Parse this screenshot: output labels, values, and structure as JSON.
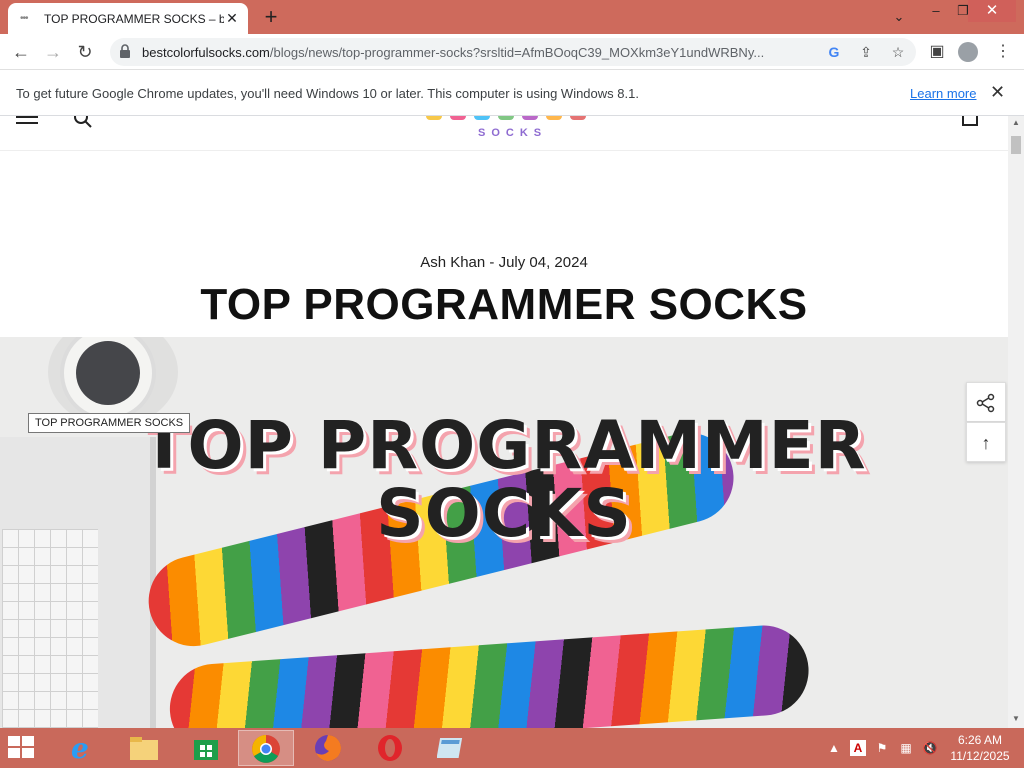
{
  "browser": {
    "tab_title": "TOP PROGRAMMER SOCKS – be",
    "new_tab_symbol": "+",
    "url_host": "bestcolorfulsocks.com",
    "url_rest": "/blogs/news/top-programmer-socks?srsltid=AfmBOoqC39_MOXkm3eY1undWRBNy...",
    "infobar_text": "To get future Google Chrome updates, you'll need Windows 10 or later. This computer is using Windows 8.1.",
    "infobar_link": "Learn more"
  },
  "site": {
    "logo_sub": "SOCKS",
    "logo_colors": [
      "#f7c84a",
      "#f06292",
      "#4fc3f7",
      "#81c784",
      "#ba68c8",
      "#ffb74d",
      "#e57373"
    ]
  },
  "article": {
    "meta": "Ash Khan - July 04, 2024",
    "title": "TOP PROGRAMMER SOCKS",
    "hero_line1": "TOP PROGRAMMER",
    "hero_line2": "SOCKS"
  },
  "tooltip": "TOP PROGRAMMER SOCKS",
  "taskbar": {
    "time": "6:26 AM",
    "date": "11/12/2025"
  }
}
